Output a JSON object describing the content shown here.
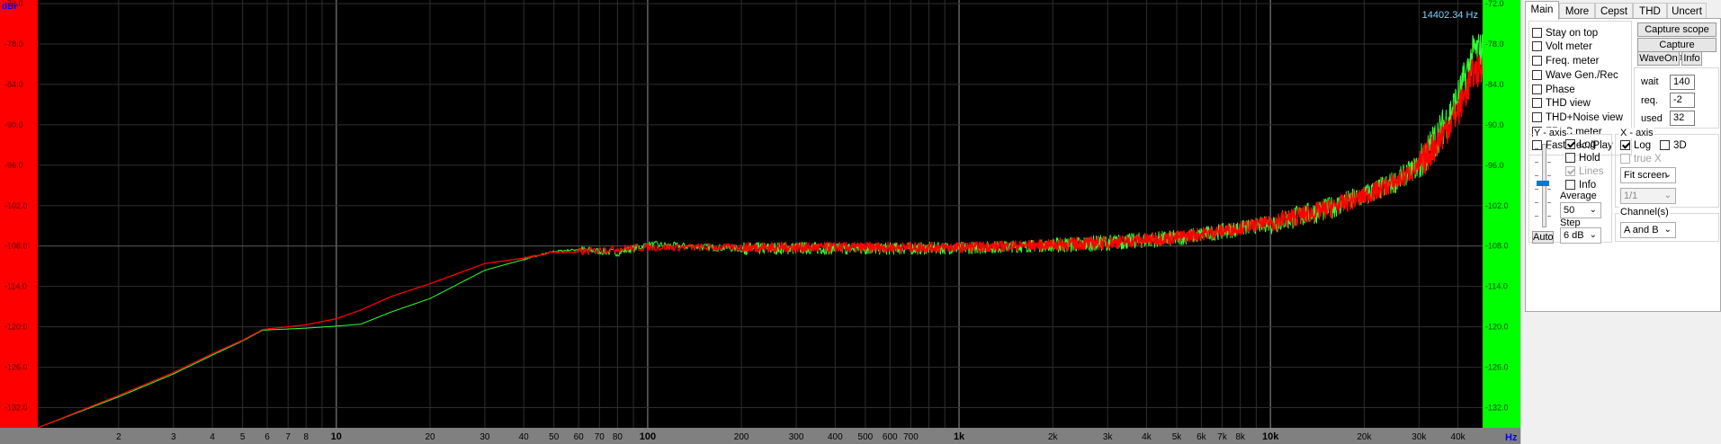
{
  "spectrum": {
    "y_unit": "dBr",
    "x_unit": "Hz",
    "readout": "14402.34 Hz",
    "y_ticks": [
      "-72.0",
      "-78.0",
      "-84.0",
      "-90.0",
      "-96.0",
      "-102.0",
      "-108.0",
      "-114.0",
      "-120.0",
      "-126.0",
      "-132.0"
    ],
    "x_labels": [
      {
        "f": 2,
        "t": "2"
      },
      {
        "f": 3,
        "t": "3"
      },
      {
        "f": 4,
        "t": "4"
      },
      {
        "f": 5,
        "t": "5"
      },
      {
        "f": 6,
        "t": "6"
      },
      {
        "f": 7,
        "t": "7"
      },
      {
        "f": 8,
        "t": "8"
      },
      {
        "f": 10,
        "t": "10"
      },
      {
        "f": 20,
        "t": "20"
      },
      {
        "f": 30,
        "t": "30"
      },
      {
        "f": 40,
        "t": "40"
      },
      {
        "f": 50,
        "t": "50"
      },
      {
        "f": 60,
        "t": "60"
      },
      {
        "f": 70,
        "t": "70"
      },
      {
        "f": 80,
        "t": "80"
      },
      {
        "f": 100,
        "t": "100"
      },
      {
        "f": 200,
        "t": "200"
      },
      {
        "f": 300,
        "t": "300"
      },
      {
        "f": 400,
        "t": "400"
      },
      {
        "f": 500,
        "t": "500"
      },
      {
        "f": 600,
        "t": "600"
      },
      {
        "f": 700,
        "t": "700"
      },
      {
        "f": 1000,
        "t": "1k"
      },
      {
        "f": 2000,
        "t": "2k"
      },
      {
        "f": 3000,
        "t": "3k"
      },
      {
        "f": 4000,
        "t": "4k"
      },
      {
        "f": 5000,
        "t": "5k"
      },
      {
        "f": 6000,
        "t": "6k"
      },
      {
        "f": 7000,
        "t": "7k"
      },
      {
        "f": 8000,
        "t": "8k"
      },
      {
        "f": 10000,
        "t": "10k"
      },
      {
        "f": 20000,
        "t": "20k"
      },
      {
        "f": 30000,
        "t": "30k"
      },
      {
        "f": 40000,
        "t": "40k"
      }
    ],
    "bold_x": [
      10,
      100,
      1000,
      10000
    ],
    "colors": {
      "bg": "#000000",
      "left_axis": "#ff0000",
      "right_axis": "#00ff00",
      "grid": "#333333",
      "channel_a": "#ff0000",
      "channel_b": "#33ff33",
      "readout": "#7fd4ff",
      "bottom_axis": "#808080",
      "unit_label": "#0000ff"
    }
  },
  "chart_data": {
    "type": "line",
    "x_scale": "log",
    "xlim": [
      1.1,
      48000
    ],
    "ylim": [
      -135,
      -72
    ],
    "xlabel": "Hz",
    "ylabel": "dBr",
    "grid": true,
    "series": [
      {
        "color": "#ff0000",
        "x": [
          1.1,
          2,
          3,
          4,
          5,
          5.8,
          8,
          10,
          12,
          15,
          20,
          30,
          40,
          50,
          60,
          80,
          100,
          200,
          300,
          500,
          1000,
          2000,
          3000,
          5000,
          6000,
          8000,
          10000,
          15000,
          20000,
          25000,
          30000,
          35000,
          40000,
          45000
        ],
        "y": [
          -135,
          -130.2,
          -126.8,
          -124,
          -122,
          -120.4,
          -119.7,
          -118.8,
          -117.5,
          -115.5,
          -113.6,
          -110.6,
          -109.8,
          -108.9,
          -108.9,
          -108.4,
          -108.2,
          -108.2,
          -108.2,
          -108.2,
          -108.2,
          -107.8,
          -107.5,
          -106.7,
          -106.2,
          -105.3,
          -104.5,
          -102.6,
          -100.6,
          -98.6,
          -96.2,
          -92,
          -88,
          -82
        ]
      },
      {
        "color": "#33ff33",
        "x": [
          1.1,
          2,
          3,
          4,
          5,
          5.8,
          8,
          10,
          12,
          15,
          20,
          30,
          40,
          50,
          60,
          80,
          100,
          200,
          300,
          500,
          1000,
          2000,
          3000,
          5000,
          6000,
          8000,
          10000,
          15000,
          20000,
          25000,
          30000,
          35000,
          40000,
          45000
        ],
        "y": [
          -135,
          -130.4,
          -127,
          -124.2,
          -122.1,
          -120.5,
          -120.2,
          -119.9,
          -119.6,
          -117.8,
          -115.8,
          -111.6,
          -110,
          -108.8,
          -108.5,
          -109,
          -107.8,
          -108.4,
          -108.3,
          -108.4,
          -108.3,
          -107.9,
          -107.5,
          -106.8,
          -106.3,
          -105.4,
          -104.6,
          -102.6,
          -100.5,
          -98.5,
          -96,
          -91,
          -86,
          -79
        ]
      }
    ]
  },
  "panel": {
    "tabs": [
      {
        "label": "Main",
        "active": true
      },
      {
        "label": "More"
      },
      {
        "label": "Cepst"
      },
      {
        "label": "THD"
      },
      {
        "label": "Uncert"
      }
    ],
    "options": [
      {
        "label": "Stay on top",
        "checked": false
      },
      {
        "label": "Volt meter",
        "checked": false
      },
      {
        "label": "Freq. meter",
        "checked": false
      },
      {
        "label": "Wave Gen./Rec",
        "checked": false
      },
      {
        "label": "Phase",
        "checked": false
      },
      {
        "label": "THD view",
        "checked": false
      },
      {
        "label": "THD+Noise view",
        "checked": false
      },
      {
        "label": "ZRLC meter",
        "checked": false
      },
      {
        "label": "Fast Rec./Play",
        "checked": false
      }
    ],
    "buttons": {
      "capture_scope": "Capture scope",
      "capture_spectrum": "Capture spectrum",
      "wave_on": "WaveOn",
      "info": "Info"
    },
    "wait_label": "wait",
    "wait_value": "140",
    "req_label": "req.",
    "req_value": "-2",
    "used_label": "used",
    "used_value": "32",
    "y_axis": {
      "title": "Y - axis",
      "log_label": "Log",
      "log": true,
      "hold_label": "Hold",
      "hold": false,
      "lines_label": "Lines",
      "lines": true,
      "info_label": "Info",
      "info": false,
      "auto_label": "Auto",
      "average_label": "Average",
      "average_value": "50",
      "step_label": "Step",
      "step_value": "6 dB",
      "slider_level": 0.48
    },
    "x_axis": {
      "title": "X - axis",
      "log_label": "Log",
      "log": true,
      "three_d_label": "3D",
      "three_d": false,
      "true_x_label": "true X",
      "true_x": false,
      "scale_value": "Fit screen",
      "ratio_value": "1/1"
    },
    "channels": {
      "title": "Channel(s)",
      "value": "A and B"
    }
  }
}
